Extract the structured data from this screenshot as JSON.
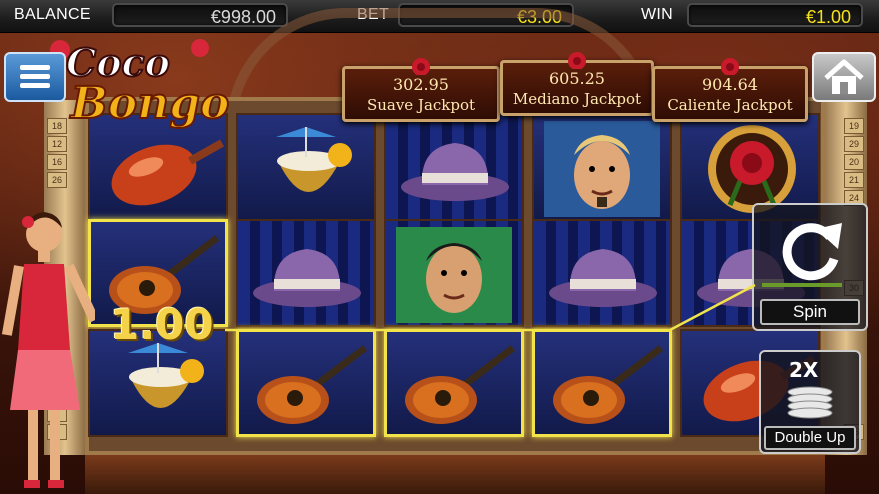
{
  "topbar": {
    "balance_label": "BALANCE",
    "balance_value": "€998.00",
    "bet_label": "BET",
    "bet_value": "€3.00",
    "win_label": "WIN",
    "win_value": "€1.00",
    "value_color": "#f5e21a",
    "balance_color": "#d9d9d9"
  },
  "logo": {
    "line1": "Coco",
    "line2": "Bongo"
  },
  "jackpots": [
    {
      "amount": "302.95",
      "name": "Suave Jackpot"
    },
    {
      "amount": "605.25",
      "name": "Mediano Jackpot"
    },
    {
      "amount": "904.64",
      "name": "Caliente Jackpot"
    }
  ],
  "buttons": {
    "menu_icon": "hamburger-icon",
    "home_icon": "home-icon",
    "spin_label": "Spin",
    "spin_icon": "refresh-icon",
    "double_label": "Double Up",
    "double_badge": "2X",
    "double_icon": "coin-stack-icon"
  },
  "win_display": "1.00",
  "line_numbers_left": [
    "18",
    "12",
    "16",
    "26",
    "",
    "",
    "",
    "",
    "",
    "",
    "",
    "",
    "",
    "",
    "",
    "",
    "4",
    "5"
  ],
  "line_numbers_right": [
    "19",
    "29",
    "20",
    "21",
    "24",
    "",
    "",
    "",
    "",
    "30",
    "",
    "",
    "",
    "",
    "",
    "",
    "",
    "25"
  ],
  "reels": [
    [
      "lollipop",
      "guitar",
      "drink"
    ],
    [
      "drink",
      "hat",
      "guitar"
    ],
    [
      "hat",
      "face-green",
      "guitar"
    ],
    [
      "face-blue",
      "hat",
      "guitar"
    ],
    [
      "rose",
      "hat",
      "lollipop"
    ]
  ],
  "winning_cells": [
    [
      0,
      1
    ],
    [
      1,
      2
    ],
    [
      2,
      2
    ],
    [
      3,
      2
    ]
  ]
}
